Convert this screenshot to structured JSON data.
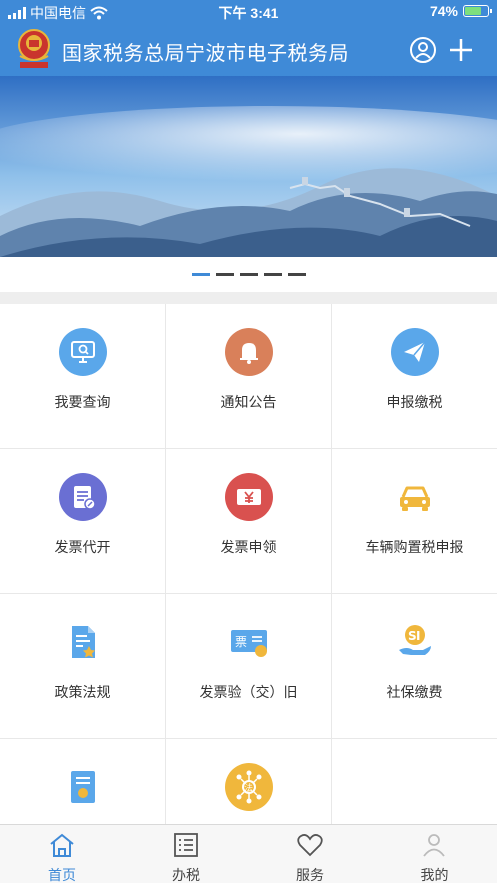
{
  "status_bar": {
    "carrier": "中国电信",
    "time": "下午 3:41",
    "battery": "74%",
    "battery_level": 0.74,
    "icons": [
      "signal-icon",
      "wifi-icon",
      "battery-icon"
    ]
  },
  "header": {
    "title": "国家税务总局宁波市电子税务局",
    "icons": [
      "tax-emblem-logo",
      "user-icon",
      "plus-icon"
    ]
  },
  "banner": {
    "slide_count": 5,
    "active_slide": 1,
    "image": "great-wall-mountains"
  },
  "colors": {
    "primary": "#3f8ad7",
    "blue_icon": "#5aa7ea",
    "orange_icon": "#d9805a",
    "purple_icon": "#6a6fd3",
    "red_icon": "#d9514f",
    "yellow_icon": "#f0b73c",
    "divider": "#eeeeee"
  },
  "grid": {
    "items": [
      {
        "label": "我要查询",
        "icon": "monitor-search-icon"
      },
      {
        "label": "通知公告",
        "icon": "bell-icon"
      },
      {
        "label": "申报缴税",
        "icon": "paper-plane-icon"
      },
      {
        "label": "发票代开",
        "icon": "document-edit-icon"
      },
      {
        "label": "发票申领",
        "icon": "yuan-ticket-icon"
      },
      {
        "label": "车辆购置税申报",
        "icon": "car-icon"
      },
      {
        "label": "政策法规",
        "icon": "policy-document-icon"
      },
      {
        "label": "发票验（交）旧",
        "icon": "invoice-verify-icon"
      },
      {
        "label": "社保缴费",
        "icon": "social-security-icon"
      },
      {
        "label": "",
        "icon": "certificate-icon"
      },
      {
        "label": "",
        "icon": "law-network-icon"
      }
    ],
    "invoice_icon_text": "票",
    "law_icon_text": "法"
  },
  "tabs": [
    {
      "label": "首页",
      "icon": "home-icon",
      "active": true
    },
    {
      "label": "办税",
      "icon": "list-icon",
      "active": false
    },
    {
      "label": "服务",
      "icon": "heart-icon",
      "active": false
    },
    {
      "label": "我的",
      "icon": "profile-icon",
      "active": false
    }
  ]
}
